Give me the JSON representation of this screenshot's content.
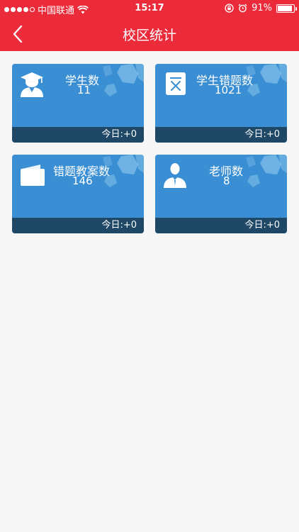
{
  "status_bar": {
    "carrier": "中国联通",
    "time": "15:17",
    "battery": "91%",
    "battery_level": 0.91
  },
  "nav": {
    "title": "校区统计",
    "back_icon": "chevron-left-icon"
  },
  "cards": [
    {
      "title": "学生数",
      "value": "11",
      "today": "今日:+0",
      "icon": "graduate-icon"
    },
    {
      "title": "学生错题数",
      "value": "1021",
      "today": "今日:+0",
      "icon": "wrong-question-icon"
    },
    {
      "title": "错题教案数",
      "value": "146",
      "today": "今日:+0",
      "icon": "folder-icon"
    },
    {
      "title": "老师数",
      "value": "8",
      "today": "今日:+0",
      "icon": "teacher-icon"
    }
  ],
  "colors": {
    "brand_red": "#eb2b3a",
    "card_blue": "#3a8fd4",
    "card_footer": "#1f4766",
    "page_bg": "#f7f7f7"
  }
}
